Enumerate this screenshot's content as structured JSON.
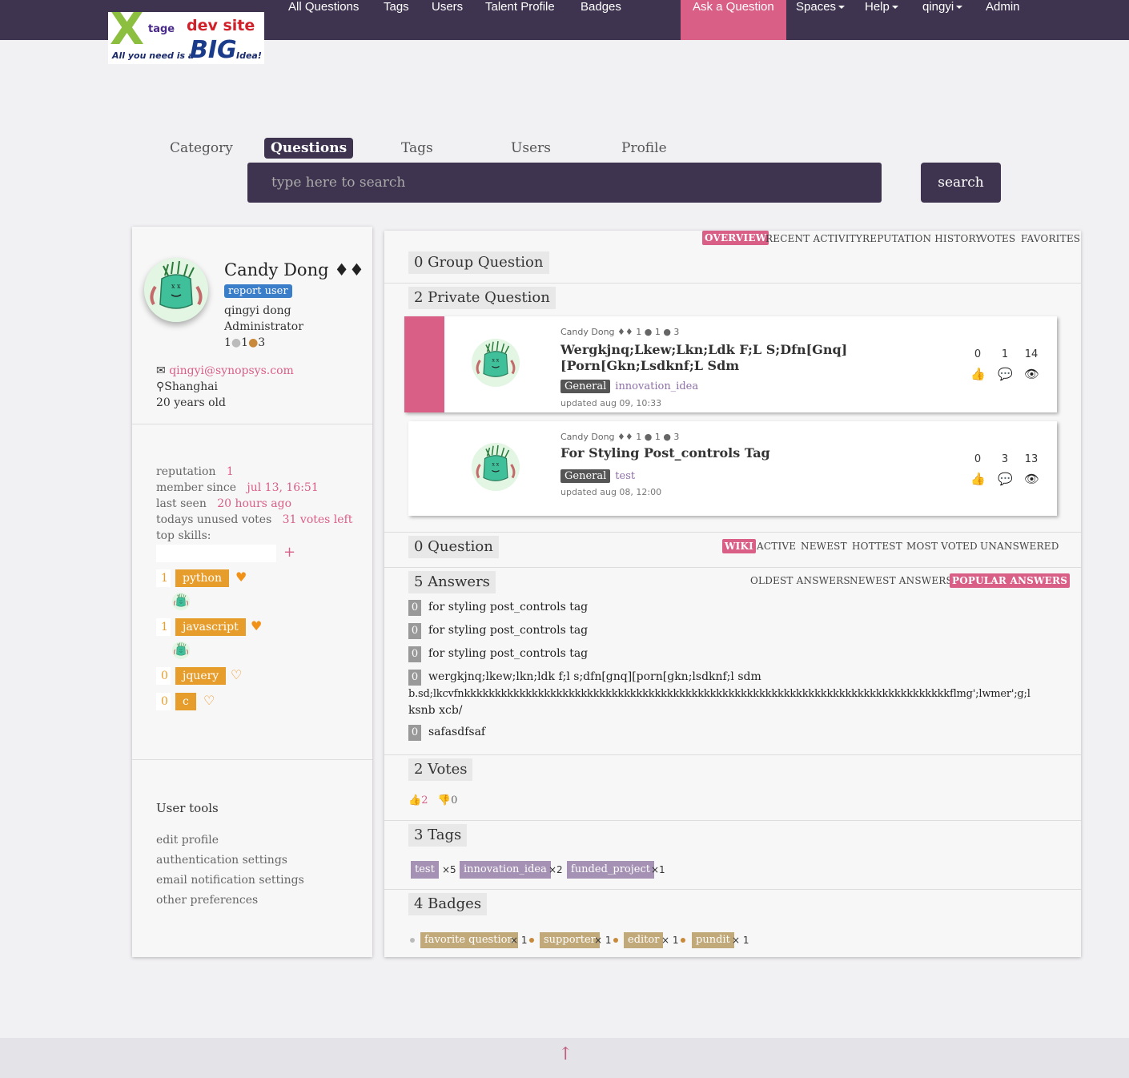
{
  "nav": {
    "logo_tage": "tage",
    "logo_dev": "dev site",
    "logo_tagline": "All you need is a",
    "logo_big": "BIG",
    "logo_idea": "Idea!",
    "items": [
      "All Questions",
      "Tags",
      "Users",
      "Talent Profile",
      "Badges"
    ],
    "ask": "Ask a Question",
    "spaces": "Spaces",
    "help": "Help",
    "user": "qingyi",
    "admin": "Admin"
  },
  "search": {
    "tabs": [
      "Category",
      "Questions",
      "Tags",
      "Users",
      "Profile"
    ],
    "active_tab": "Questions",
    "placeholder": "type here to search",
    "button": "search"
  },
  "profile": {
    "name": "Candy Dong",
    "name_marks": "♦♦",
    "report": "report user",
    "fullname": "qingyi dong",
    "role": "Administrator",
    "badges_line": [
      "1",
      "1",
      "3"
    ],
    "email": "qingyi@synopsys.com",
    "location": "Shanghai",
    "age": "20 years old",
    "stats": [
      {
        "label": "reputation",
        "value": "1"
      },
      {
        "label": "member since",
        "value": "jul 13, 16:51"
      },
      {
        "label": "last seen",
        "value": "20 hours ago"
      },
      {
        "label": "todays unused votes",
        "value": "31 votes left"
      }
    ],
    "top_skills_label": "top skills:",
    "add": "+",
    "skills": [
      {
        "count": "1",
        "name": "python",
        "heart": "♥"
      },
      {
        "count": "1",
        "name": "javascript",
        "heart": "♥"
      },
      {
        "count": "0",
        "name": "jquery",
        "heart": "♡"
      },
      {
        "count": "0",
        "name": "c",
        "heart": "♡"
      }
    ],
    "tools_title": "User tools",
    "tools": [
      "edit profile",
      "authentication settings",
      "email notification settings",
      "other preferences"
    ]
  },
  "tabs": {
    "items": [
      "OVERVIEW",
      "RECENT ACTIVITY",
      "REPUTATION HISTORY",
      "VOTES",
      "FAVORITES"
    ],
    "active": "OVERVIEW"
  },
  "sections": {
    "group": "0 Group Question",
    "private": "2 Private Question",
    "question": "0 Question",
    "answers": "5 Answers",
    "votes": "2 Votes",
    "tags": "3 Tags",
    "badges": "4 Badges"
  },
  "questions": [
    {
      "meta": "Candy Dong ♦♦ 1  ● 1  ● 3",
      "title": "Wergkjnq;Lkew;Lkn;Ldk F;L S;Dfn[Gnq][Porn[Gkn;Lsdknf;L Sdm",
      "cat": "General",
      "tag": "innovation_idea",
      "updated": "updated aug 09, 10:33",
      "votes": "0",
      "answers": "1",
      "views": "14"
    },
    {
      "meta": "Candy Dong ♦♦ 1  ● 1  ● 3",
      "title": "For Styling Post_controls Tag",
      "cat": "General",
      "tag": "test",
      "updated": "updated aug 08, 12:00",
      "votes": "0",
      "answers": "3",
      "views": "13"
    }
  ],
  "qtabs": {
    "items": [
      "WIKI",
      "ACTIVE",
      "NEWEST",
      "HOTTEST",
      "MOST VOTED",
      "UNANSWERED"
    ],
    "active": "WIKI"
  },
  "atabs": {
    "items": [
      "OLDEST ANSWERS",
      "NEWEST ANSWERS",
      "POPULAR ANSWERS"
    ],
    "active": "POPULAR ANSWERS"
  },
  "answers": [
    {
      "n": "0",
      "text": "for styling post_controls tag"
    },
    {
      "n": "0",
      "text": "for styling post_controls tag"
    },
    {
      "n": "0",
      "text": "for styling post_controls tag"
    },
    {
      "n": "0",
      "text": "wergkjnq;lkew;lkn;ldk f;l s;dfn[gnq][porn[gkn;lsdknf;l sdm",
      "cont1": "b.sd;lkcvfnkkkkkkkkkkkkkkkkkkkkkkkkkkkkkkkkkkkkkkkkkkkkkkkkkkkkkkkkkkkkkkkkkkkkkkkkkkkkkkkflmg';lwmer';g;l",
      "cont2": "ksnb xcb/"
    },
    {
      "n": "0",
      "text": "safasdfsaf"
    }
  ],
  "votes": {
    "up": "2",
    "down": "0"
  },
  "tags": [
    {
      "name": "test",
      "count": "×5"
    },
    {
      "name": "innovation_idea",
      "count": "×2"
    },
    {
      "name": "funded_project",
      "count": "×1"
    }
  ],
  "badges": [
    {
      "name": "favorite question",
      "count": "× 1"
    },
    {
      "name": "supporter",
      "count": "× 1"
    },
    {
      "name": "editor",
      "count": "× 1"
    },
    {
      "name": "pundit",
      "count": "× 1"
    }
  ],
  "footer": {
    "up": "↑"
  },
  "colors": {
    "accent": "#d95f87",
    "header": "#3e3450",
    "skill": "#e69d2b",
    "tag": "#a491b3",
    "badge": "#c1a97a"
  }
}
